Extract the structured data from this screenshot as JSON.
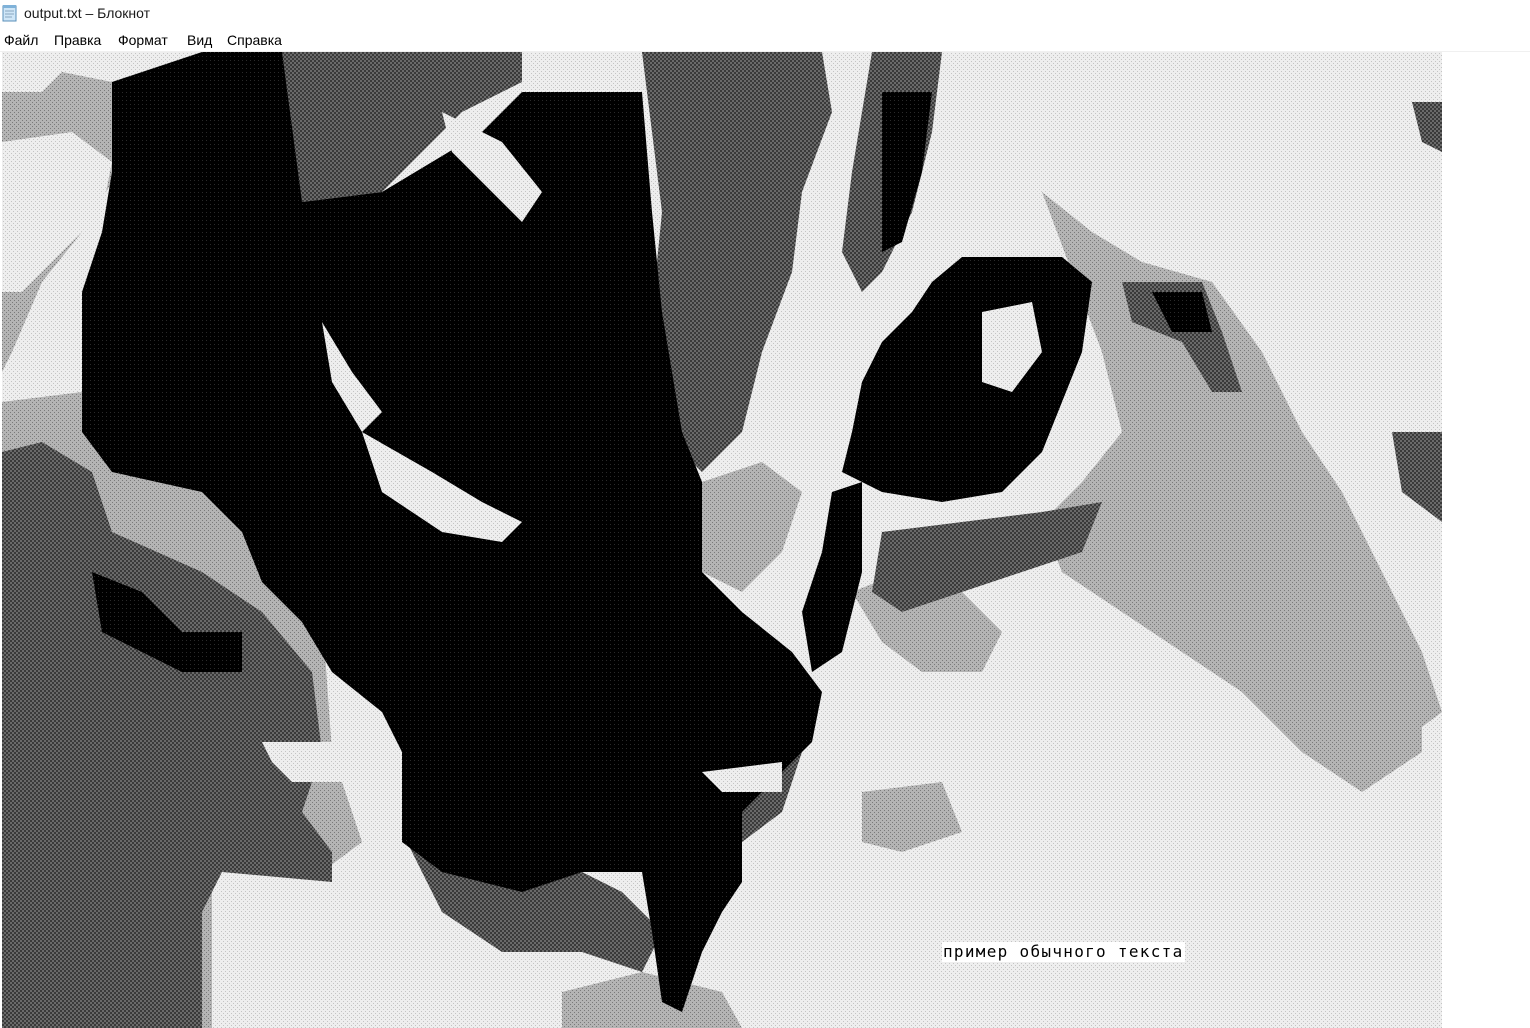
{
  "window": {
    "title": "output.txt – Блокнот",
    "icon": "notepad-icon"
  },
  "menu": [
    {
      "label": "Файл"
    },
    {
      "label": "Правка"
    },
    {
      "label": "Формат"
    },
    {
      "label": "Вид"
    },
    {
      "label": "Справка"
    }
  ],
  "document": {
    "plain_text": "пример обычного текста",
    "art_description": "ASCII-art rendering of a cat's face in black, dark grey, mid grey and light grey character shades"
  },
  "colors": {
    "shade_black": "#050505",
    "shade_dark": "#5e5e5e",
    "shade_mid": "#a6a6a6",
    "shade_light": "#e7e7e7"
  }
}
